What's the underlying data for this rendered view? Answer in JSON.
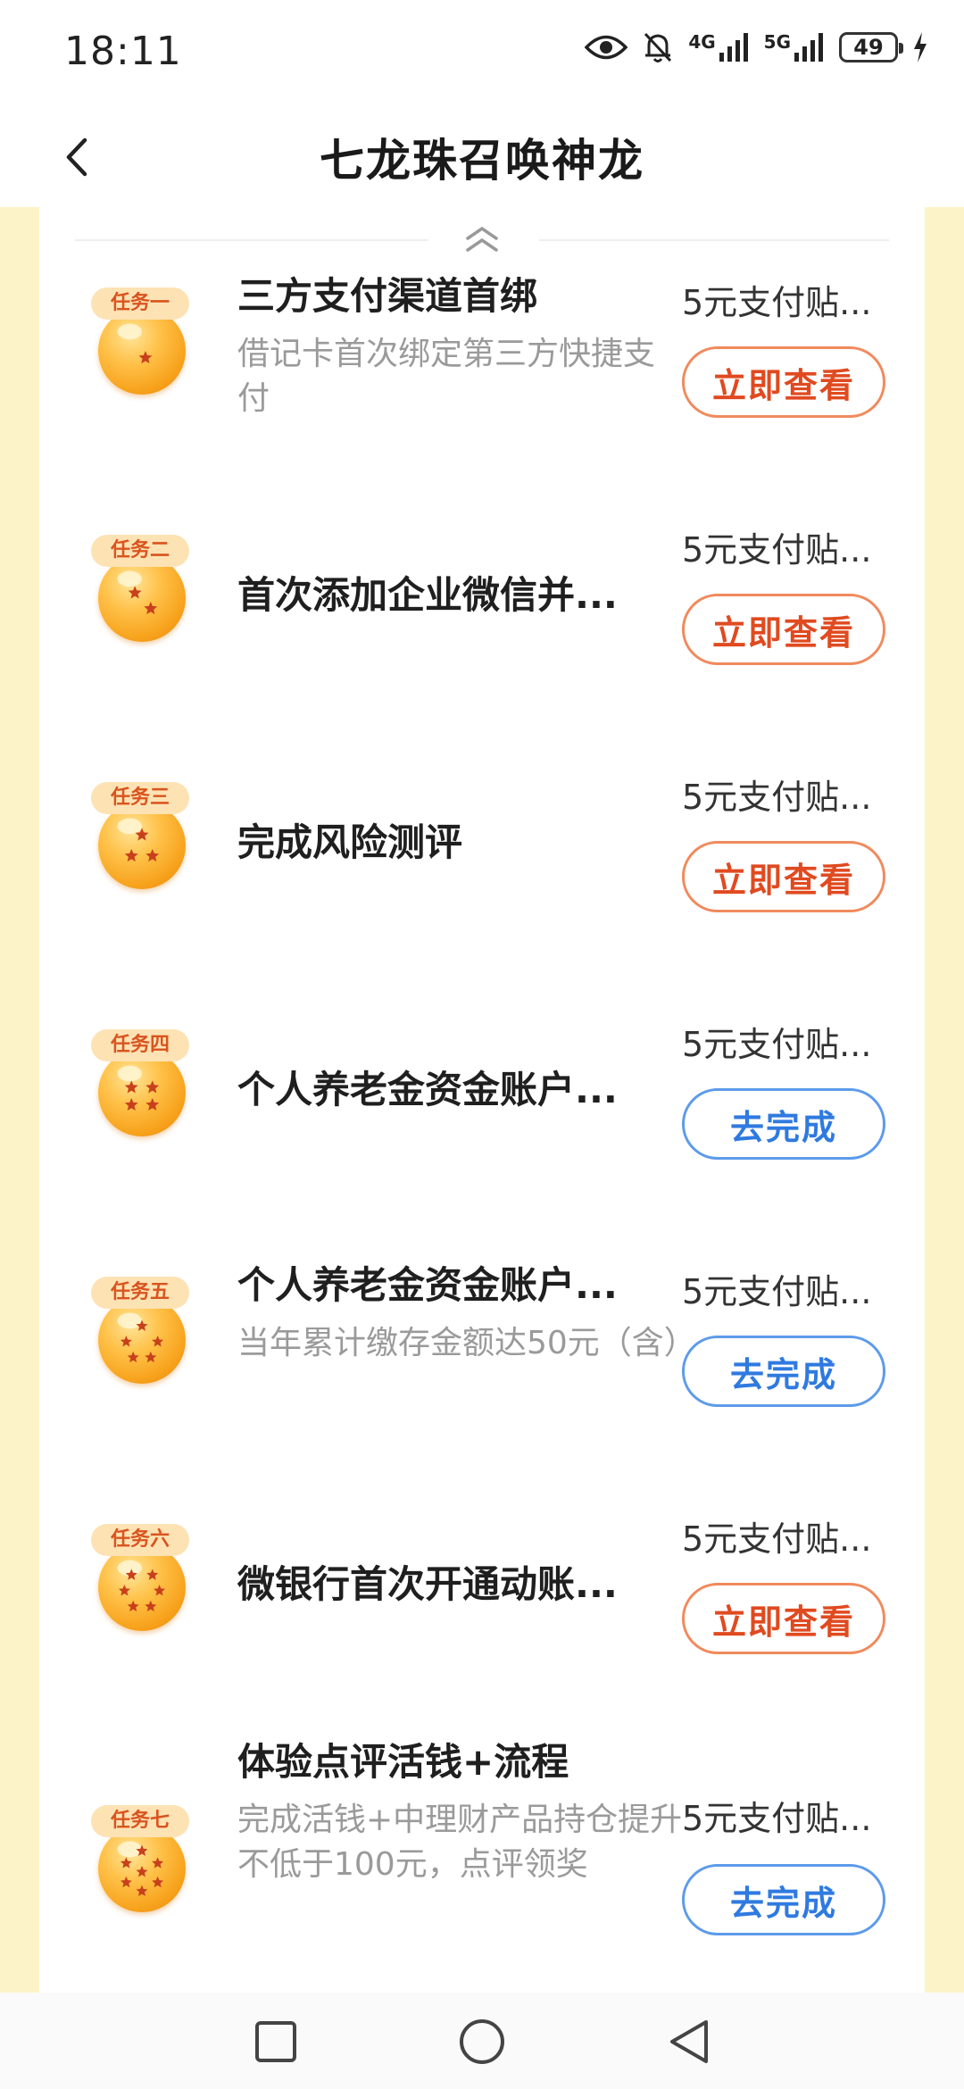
{
  "status_bar": {
    "time": "18:11",
    "net_4g": "4G",
    "net_5g": "5G",
    "battery": "49"
  },
  "header": {
    "title": "七龙珠召唤神龙"
  },
  "colors": {
    "page_bg_yellow": "#fdf3c8",
    "tag_bg": "#fde2b4",
    "tag_text": "#d9541e",
    "orange_button": "#e04a20",
    "blue_button": "#2f7ae0"
  },
  "tasks": [
    {
      "tag": "任务一",
      "title": "三方支付渠道首绑",
      "desc": "借记卡首次绑定第三方快捷支付",
      "reward": "5元支付贴...",
      "button": "立即查看",
      "button_style": "orange",
      "stars": 1
    },
    {
      "tag": "任务二",
      "title": "首次添加企业微信并...",
      "desc": "",
      "reward": "5元支付贴...",
      "button": "立即查看",
      "button_style": "orange",
      "stars": 2
    },
    {
      "tag": "任务三",
      "title": "完成风险测评",
      "desc": "",
      "reward": "5元支付贴...",
      "button": "立即查看",
      "button_style": "orange",
      "stars": 3
    },
    {
      "tag": "任务四",
      "title": "个人养老金资金账户...",
      "desc": "",
      "reward": "5元支付贴...",
      "button": "去完成",
      "button_style": "blue",
      "stars": 4
    },
    {
      "tag": "任务五",
      "title": "个人养老金资金账户...",
      "desc": "当年累计缴存金额达50元（含）",
      "reward": "5元支付贴...",
      "button": "去完成",
      "button_style": "blue",
      "stars": 5
    },
    {
      "tag": "任务六",
      "title": "微银行首次开通动账...",
      "desc": "",
      "reward": "5元支付贴...",
      "button": "立即查看",
      "button_style": "orange",
      "stars": 6
    },
    {
      "tag": "任务七",
      "title": "体验点评活钱+流程",
      "desc": "完成活钱+中理财产品持仓提升不低于100元，点评领奖",
      "reward": "5元支付贴...",
      "button": "去完成",
      "button_style": "blue",
      "stars": 7
    }
  ]
}
